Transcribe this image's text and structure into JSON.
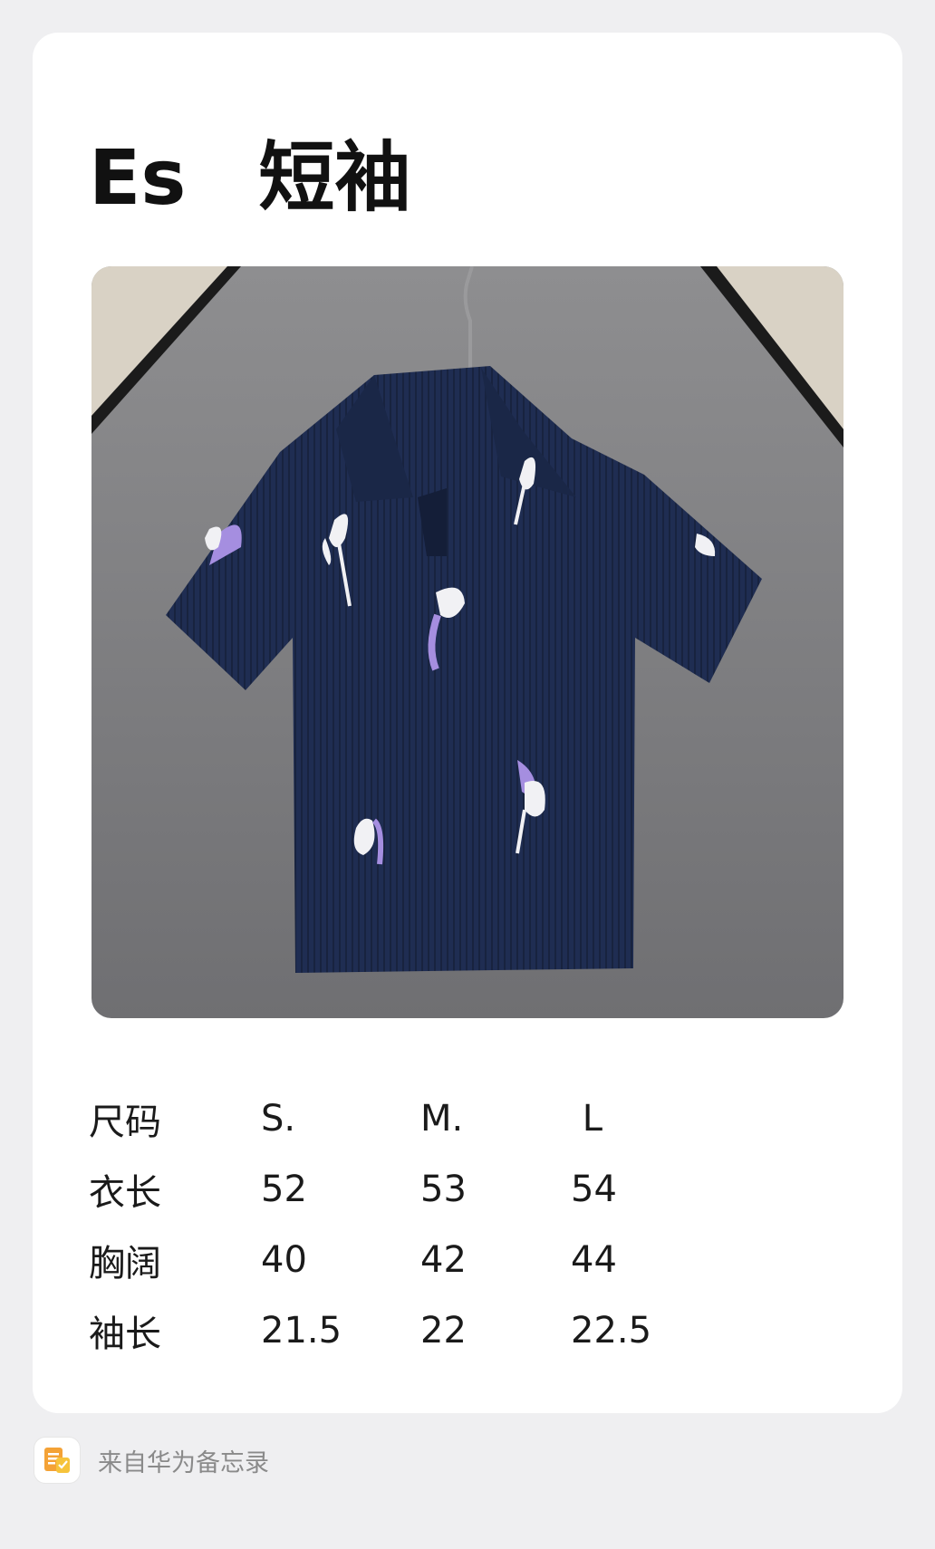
{
  "note": {
    "title_brand": "Es",
    "title_item": "短袖"
  },
  "photo": {
    "icon": "product-photo",
    "colors": {
      "background": "#8a8a8c",
      "garment": "#1f2d52",
      "flower_white": "#f1f1f4",
      "flower_purple": "#a58ee0"
    }
  },
  "size_table": {
    "rows": [
      [
        "尺码",
        "S.",
        "M.",
        " L"
      ],
      [
        "衣长",
        "52",
        "53",
        "54"
      ],
      [
        "胸阔",
        "40",
        "42",
        "44"
      ],
      [
        "袖长",
        "21.5",
        "22",
        "22.5"
      ]
    ]
  },
  "footer": {
    "icon": "notes-app-icon",
    "text": "来自华为备忘录"
  }
}
